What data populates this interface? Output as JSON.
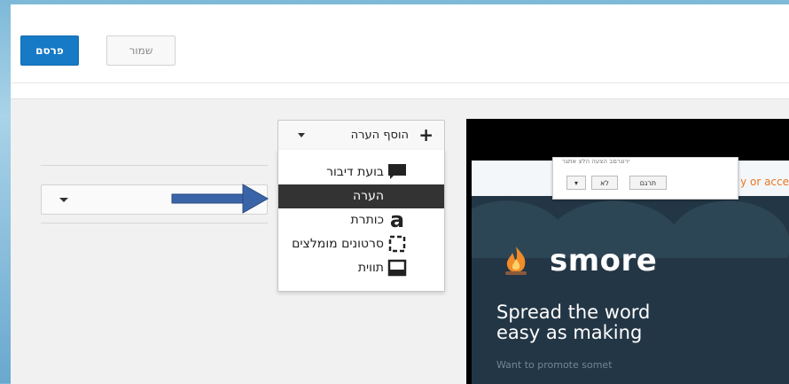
{
  "toolbar": {
    "publish_label": "פרסם",
    "save_label": "שמור"
  },
  "editor": {
    "add_annotation_label": "הוסף הערה",
    "menu_items": [
      {
        "label": "בועת דיבור",
        "icon": "speech-bubble-icon"
      },
      {
        "label": "הערה",
        "icon": "note-icon",
        "selected": true
      },
      {
        "label": "כותרת",
        "icon": "title-icon"
      },
      {
        "label": "סרטונים מומלצים",
        "icon": "spotlight-icon"
      },
      {
        "label": "תווית",
        "icon": "label-icon"
      }
    ]
  },
  "video": {
    "top_text": "y or acce",
    "dialog": {
      "text": "ירוגרםב הצעה הלצ אתגר",
      "translate_label": "תרגם",
      "no_label": "לא"
    },
    "logo_text": "smore",
    "headline_line1": "Spread the word",
    "headline_line2": "easy as making",
    "subline": "Want to promote somet"
  },
  "colors": {
    "publish": "#167ac6",
    "menu_selected": "#333333",
    "video_bg": "#233645",
    "arrow": "#3a64a8"
  }
}
